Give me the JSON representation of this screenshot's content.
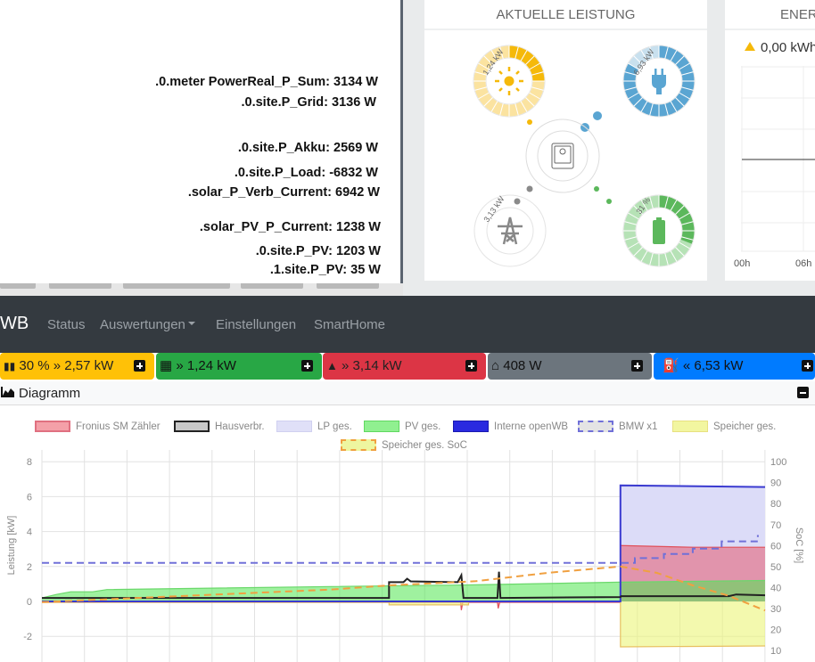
{
  "debug_panel": {
    "lines": [
      ".0.meter PowerReal_P_Sum: 3134 W",
      ".0.site.P_Grid: 3136 W",
      ".0.site.P_Akku: 2569 W",
      ".0.site.P_Load: -6832 W",
      ".solar_P_Verb_Current: 6942 W",
      ".solar_PV_P_Current: 1238 W",
      ".0.site.P_PV: 1203 W",
      ".1.site.P_PV: 35 W"
    ]
  },
  "power_card": {
    "title": "AKTUELLE LEISTUNG",
    "pv_label": "1,24 kW",
    "load_label": "6,93 kW",
    "grid_label": "3,13 kW",
    "battery_label": "31 %",
    "pv_fraction": 0.25,
    "load_fraction": 0.83,
    "battery_fraction": 0.31,
    "colors": {
      "pv": "#f5b90a",
      "load": "#5aa5d2",
      "grid": "#8a8a8a",
      "battery": "#5cb85c"
    }
  },
  "energy_card": {
    "title": "ENER",
    "value": "0,00 kWh",
    "x_ticks": [
      "00h",
      "06h"
    ]
  },
  "navbar": {
    "brand": "WB",
    "links": [
      "Status",
      "Auswertungen",
      "Einstellungen",
      "SmartHome"
    ]
  },
  "status_boxes": [
    {
      "label": "30 % » 2,57 kW",
      "color": "#ffc107"
    },
    {
      "label": "» 1,24 kW",
      "color": "#28a745"
    },
    {
      "label": "» 3,14 kW",
      "color": "#dc3545"
    },
    {
      "label": "408 W",
      "color": "#6c757d"
    },
    {
      "label": "« 6,53 kW",
      "color": "#007bff"
    }
  ],
  "diagram": {
    "title": "Diagramm"
  },
  "chart_data": {
    "type": "line",
    "ylabel": "Leistung [kW]",
    "y2label": "SoC [%]",
    "ylim": [
      -3.4,
      8
    ],
    "y_ticks": [
      "8",
      "6",
      "4",
      "2",
      "0",
      "-2"
    ],
    "y2lim": [
      5,
      100
    ],
    "y2_ticks": [
      "100",
      "90",
      "80",
      "70",
      "60",
      "50",
      "40",
      "30",
      "20",
      "10"
    ],
    "grid": true,
    "legend": "top",
    "legend_items": [
      "Fronius SM Zähler",
      "Hausverbr.",
      "LP ges.",
      "PV ges.",
      "Interne openWB",
      "BMW x1",
      "Speicher ges.",
      "Speicher ges. SoC"
    ],
    "series": [
      {
        "name": "LP ges.",
        "axis": "kW",
        "kind": "area",
        "color": "#dcdcf8",
        "line": "#c8c8ee",
        "points": [
          [
            0,
            0
          ],
          [
            80,
            0
          ],
          [
            80,
            6.6
          ],
          [
            100,
            6.55
          ]
        ]
      },
      {
        "name": "Fronius SM Zähler",
        "axis": "kW",
        "kind": "area",
        "color": "rgba(230,90,110,0.55)",
        "line": "#e0505a",
        "points": [
          [
            0,
            -0.05
          ],
          [
            57.9,
            -0.05
          ],
          [
            58,
            -0.5
          ],
          [
            58.2,
            -0.05
          ],
          [
            63,
            -0.05
          ],
          [
            63.1,
            -0.4
          ],
          [
            63.3,
            -0.05
          ],
          [
            80,
            -0.05
          ],
          [
            80,
            3.2
          ],
          [
            90,
            3.1
          ],
          [
            100,
            3.1
          ]
        ]
      },
      {
        "name": "PV ges.",
        "axis": "kW",
        "kind": "area",
        "color": "rgba(80,230,80,0.55)",
        "line": "#6bd86b",
        "points": [
          [
            0,
            0.2
          ],
          [
            2,
            0.4
          ],
          [
            4,
            0.55
          ],
          [
            7,
            0.55
          ],
          [
            9,
            0.68
          ],
          [
            40,
            0.85
          ],
          [
            60,
            0.95
          ],
          [
            80,
            1.1
          ],
          [
            100,
            1.2
          ]
        ]
      },
      {
        "name": "Speicher ges.",
        "axis": "kW",
        "kind": "area",
        "color": "rgba(235,245,120,0.6)",
        "line": "#e8c060",
        "points": [
          [
            0,
            -0.05
          ],
          [
            48,
            -0.05
          ],
          [
            48,
            -0.2
          ],
          [
            59,
            -0.2
          ],
          [
            59,
            0
          ],
          [
            80,
            0
          ],
          [
            80,
            -2.6
          ],
          [
            100,
            -2.55
          ]
        ]
      },
      {
        "name": "Interne openWB",
        "axis": "kW",
        "kind": "line",
        "color": "#3a3ad0",
        "width": 2,
        "points": [
          [
            0,
            0
          ],
          [
            80,
            0
          ],
          [
            80,
            6.65
          ],
          [
            100,
            6.55
          ]
        ]
      },
      {
        "name": "Hausverbr.",
        "axis": "kW",
        "kind": "line",
        "color": "#222",
        "width": 2,
        "points": [
          [
            0,
            0.2
          ],
          [
            48,
            0.2
          ],
          [
            48,
            1.1
          ],
          [
            50,
            1.1
          ],
          [
            50.5,
            1.3
          ],
          [
            51,
            1.15
          ],
          [
            57.5,
            1.1
          ],
          [
            58,
            1.5
          ],
          [
            58.3,
            0.2
          ],
          [
            63,
            0.2
          ],
          [
            63.2,
            1.7
          ],
          [
            63.4,
            0.2
          ],
          [
            80,
            0.25
          ],
          [
            80.1,
            0.3
          ],
          [
            95,
            0.3
          ],
          [
            96,
            0.4
          ],
          [
            100,
            0.35
          ]
        ]
      },
      {
        "name": "BMW x1",
        "axis": "soc",
        "kind": "dash",
        "color": "#7070d8",
        "width": 2,
        "points": [
          [
            0,
            51.7
          ],
          [
            82,
            51.7
          ],
          [
            82,
            54
          ],
          [
            86,
            54
          ],
          [
            86,
            56
          ],
          [
            90,
            56
          ],
          [
            90,
            58.5
          ],
          [
            94,
            58.5
          ],
          [
            94,
            62
          ],
          [
            99,
            62
          ],
          [
            99,
            65
          ]
        ]
      },
      {
        "name": "Speicher ges. SoC",
        "axis": "soc",
        "kind": "dash",
        "color": "#f0a040",
        "width": 2,
        "points": [
          [
            0,
            33
          ],
          [
            20,
            36
          ],
          [
            40,
            39
          ],
          [
            48,
            41
          ],
          [
            60,
            43
          ],
          [
            70,
            47
          ],
          [
            80,
            50
          ],
          [
            85,
            47
          ],
          [
            90,
            41
          ],
          [
            95,
            36
          ],
          [
            100,
            29
          ]
        ]
      }
    ]
  }
}
